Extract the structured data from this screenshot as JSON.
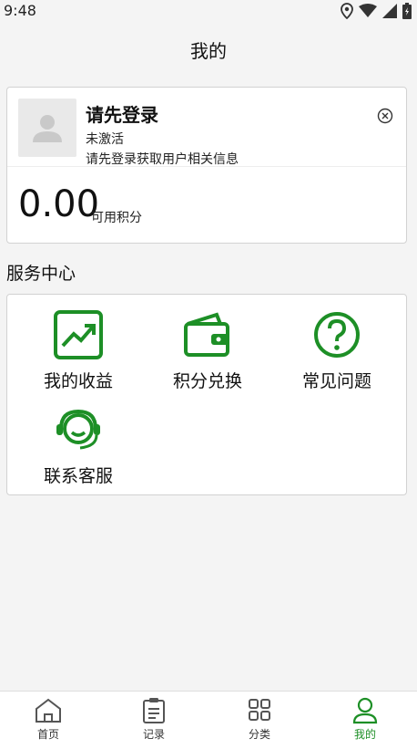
{
  "status_bar": {
    "time": "9:48"
  },
  "header": {
    "title": "我的"
  },
  "profile": {
    "login_title": "请先登录",
    "account_status": "未激活",
    "login_hint": "请先登录获取用户相关信息",
    "points_value": "0.00",
    "points_label": "可用积分"
  },
  "services": {
    "section_title": "服务中心",
    "items": [
      {
        "label": "我的收益",
        "icon": "earnings-chart-icon"
      },
      {
        "label": "积分兑换",
        "icon": "wallet-icon"
      },
      {
        "label": "常见问题",
        "icon": "question-icon"
      },
      {
        "label": "联系客服",
        "icon": "headset-icon"
      }
    ]
  },
  "bottom_nav": {
    "items": [
      {
        "label": "首页",
        "icon": "home-icon"
      },
      {
        "label": "记录",
        "icon": "clipboard-icon"
      },
      {
        "label": "分类",
        "icon": "grid-icon"
      },
      {
        "label": "我的",
        "icon": "user-icon",
        "active": true
      }
    ]
  },
  "colors": {
    "accent": "#1d8f26",
    "background": "#f4f4f4",
    "card": "#ffffff"
  }
}
